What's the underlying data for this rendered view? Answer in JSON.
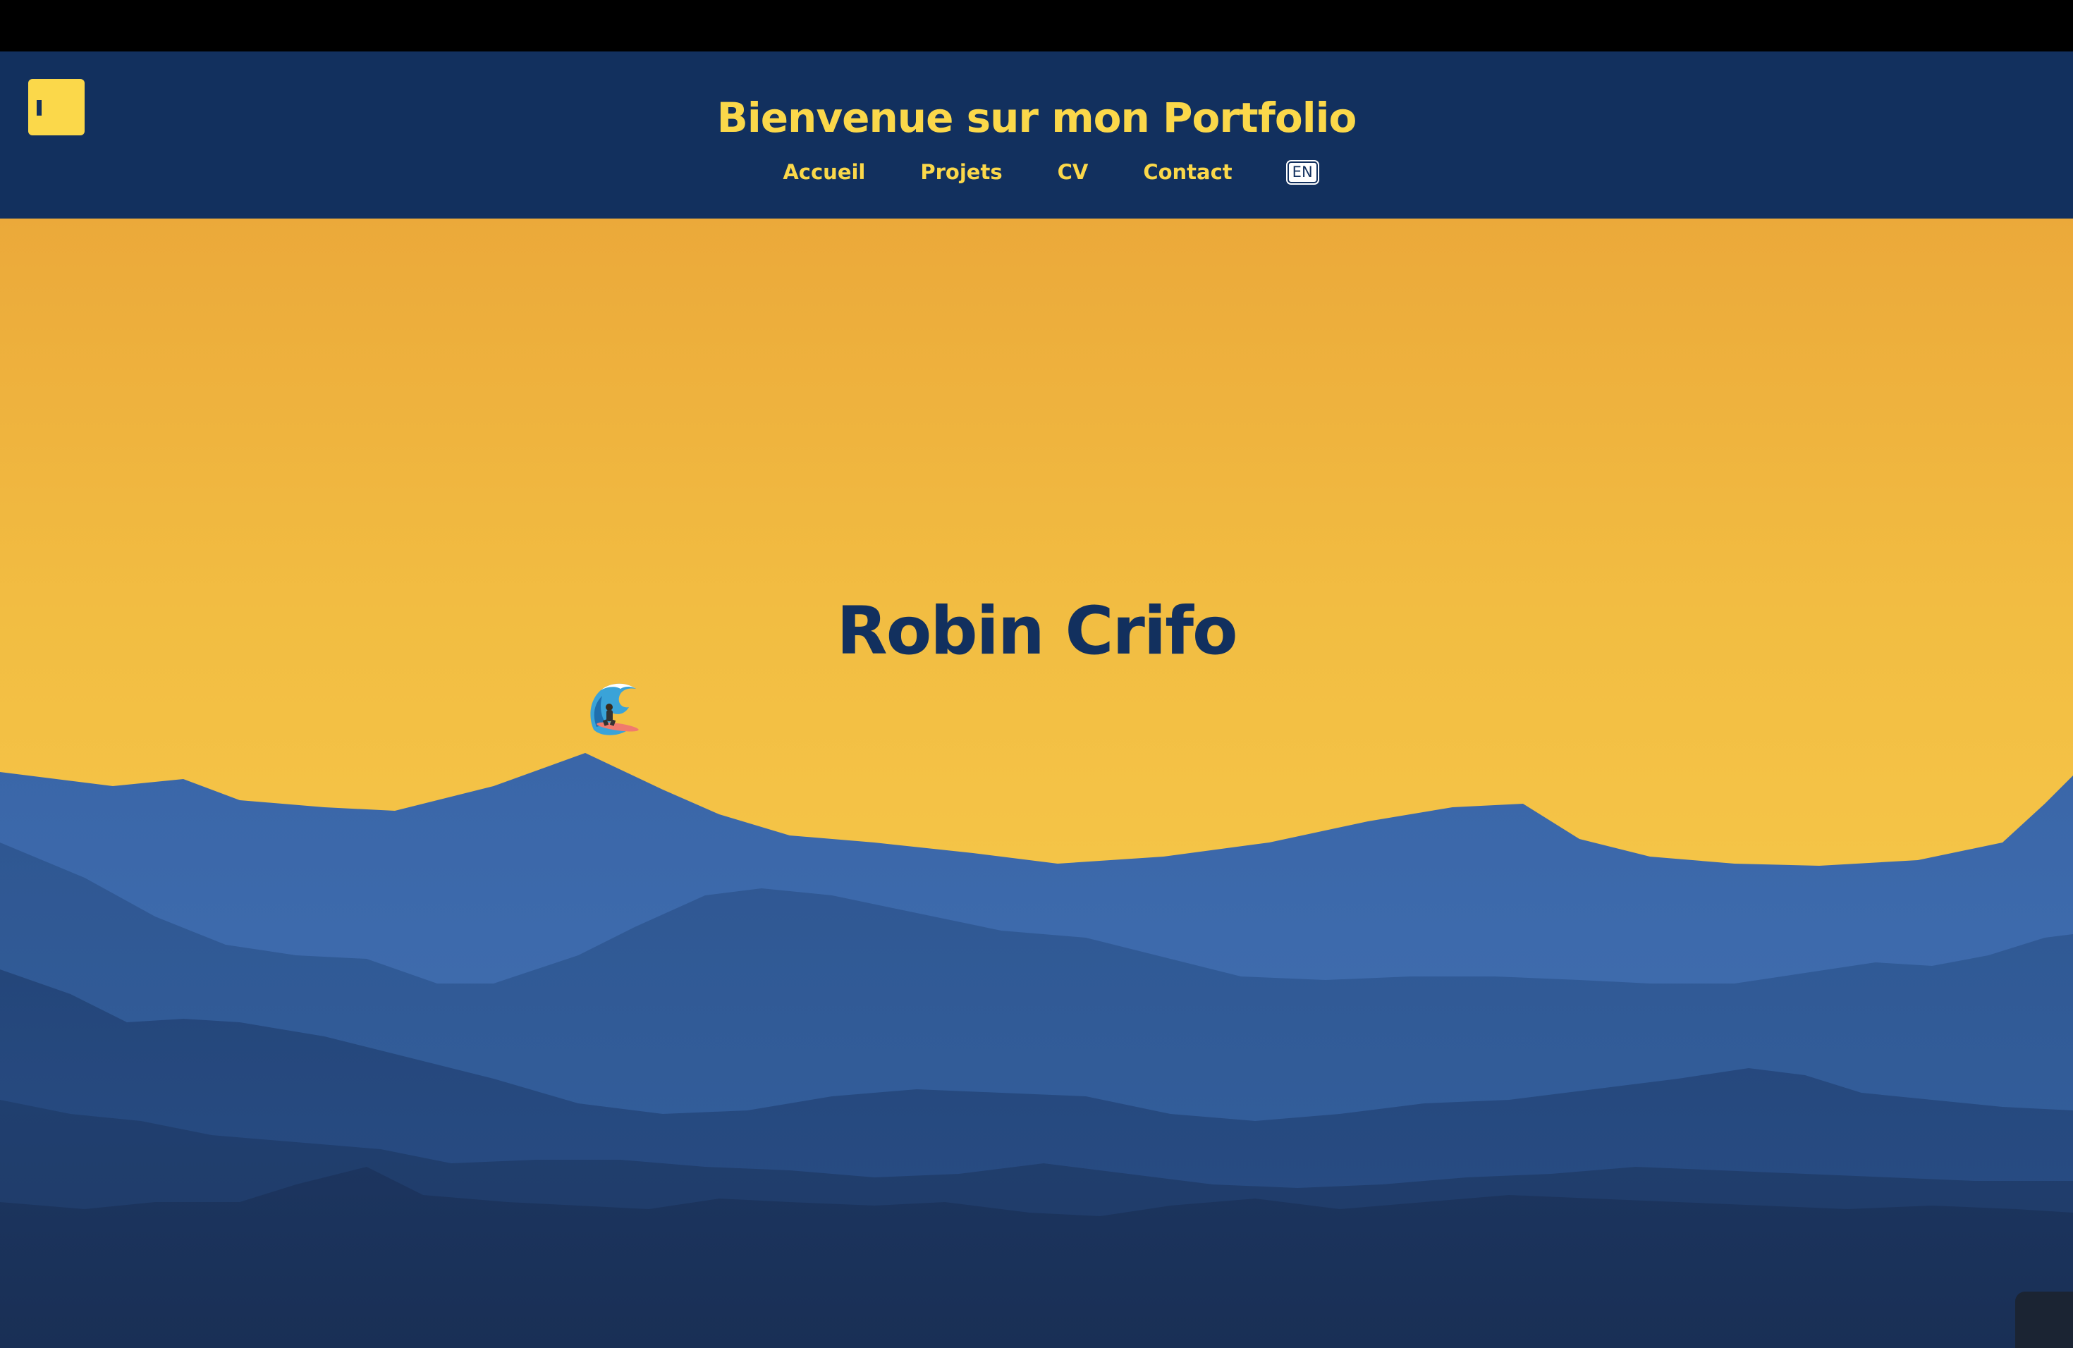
{
  "header": {
    "title": "Bienvenue sur mon Portfolio",
    "nav": [
      {
        "label": "Accueil"
      },
      {
        "label": "Projets"
      },
      {
        "label": "CV"
      },
      {
        "label": "Contact"
      }
    ],
    "language": "EN"
  },
  "hero": {
    "name": "Robin Crifo",
    "decoration_icon": "surfer-wave-icon"
  },
  "colors": {
    "header_bg": "#12305e",
    "accent_yellow": "#fbd84a",
    "sky_top": "#eba93a",
    "sky_bottom": "#f7cb4c",
    "mountain_light": "#3b67a8",
    "mountain_mid": "#2f5894",
    "mountain_dark": "#1c3560"
  }
}
